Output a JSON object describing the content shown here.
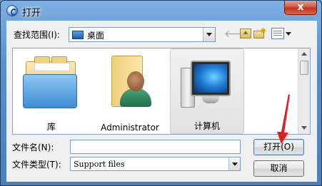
{
  "window": {
    "title": "打开",
    "close_label": "x"
  },
  "toolbar": {
    "lookin_label": "查找范围(I):",
    "lookin_value": "桌面",
    "icons": [
      "back-arrow-icon",
      "up-folder-icon",
      "new-folder-icon",
      "view-menu-icon"
    ]
  },
  "files": [
    {
      "label": "库",
      "icon": "library-icon",
      "selected": false
    },
    {
      "label": "Administrator",
      "icon": "user-folder-icon",
      "selected": false
    },
    {
      "label": "计算机",
      "icon": "computer-icon",
      "selected": true
    }
  ],
  "bottom": {
    "filename_label": "文件名(N):",
    "filename_value": "",
    "filetype_label": "文件类型(T):",
    "filetype_value": "Support files",
    "open_button": "打开(O)",
    "cancel_button": "取消"
  },
  "colors": {
    "annotation_arrow": "#e02020",
    "frame": "#5b8fca"
  }
}
